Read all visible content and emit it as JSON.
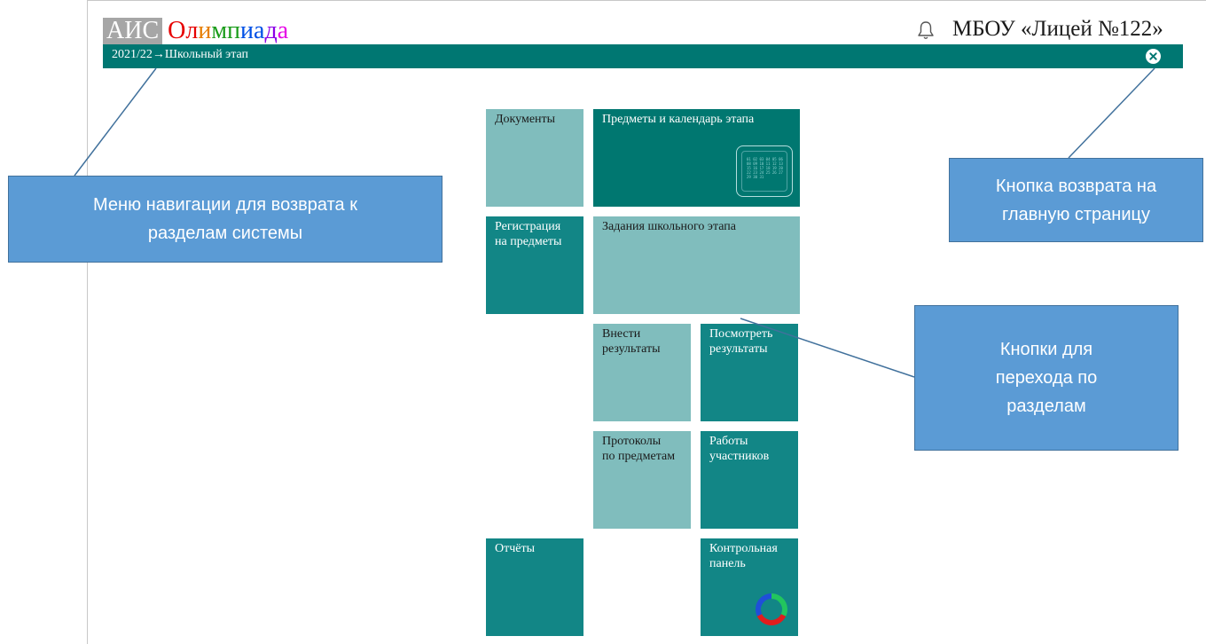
{
  "header": {
    "logo_prefix": "АИС",
    "logo_word": "Олимпиада",
    "logo_letter_colors": [
      "#e60000",
      "#e60000",
      "#e67e00",
      "#1a9c1a",
      "#1a9c1a",
      "#0050e6",
      "#0050e6",
      "#8b00e6",
      "#e600e6"
    ],
    "school_name": "МБОУ «Лицей №122»",
    "bell_icon": "bell-icon"
  },
  "navbar": {
    "breadcrumb": "2021/22→Школьный этап",
    "close_icon": "close-icon",
    "color": "#007772"
  },
  "tiles": {
    "documents": "Документы",
    "subjects_calendar": "Предметы и календарь этапа",
    "registration": "Регистрация\nна предметы",
    "tasks": "Задания школьного этапа",
    "enter_results": "Внести\nрезультаты",
    "view_results": "Посмотреть\nрезультаты",
    "protocols": "Протоколы\nпо предметам",
    "participant_works": "Работы\nучастников",
    "reports": "Отчёты",
    "control_panel": "Контрольная\nпанель"
  },
  "calendar_icon": {
    "name": "calendar-icon",
    "grid_text": "01 02 03 04 05 06\n08 09 10 11 12 13\n15 16 17 18 19 20\n22 23 24 25 26 27\n29 30 31"
  },
  "ring_icon": {
    "name": "ring-chart-icon",
    "colors": [
      "#1f4fd8",
      "#22c55e",
      "#e11d1d"
    ]
  },
  "callouts": {
    "navigation": "Меню навигации для возврата к\nразделам системы",
    "home_button": "Кнопка возврата на\nглавную страницу",
    "sections": "Кнопки для\nперехода по\nразделам"
  },
  "colors": {
    "tile_light": "#80bdbd",
    "tile_mid": "#128686",
    "tile_dark": "#007770",
    "callout": "#5b9bd5"
  }
}
